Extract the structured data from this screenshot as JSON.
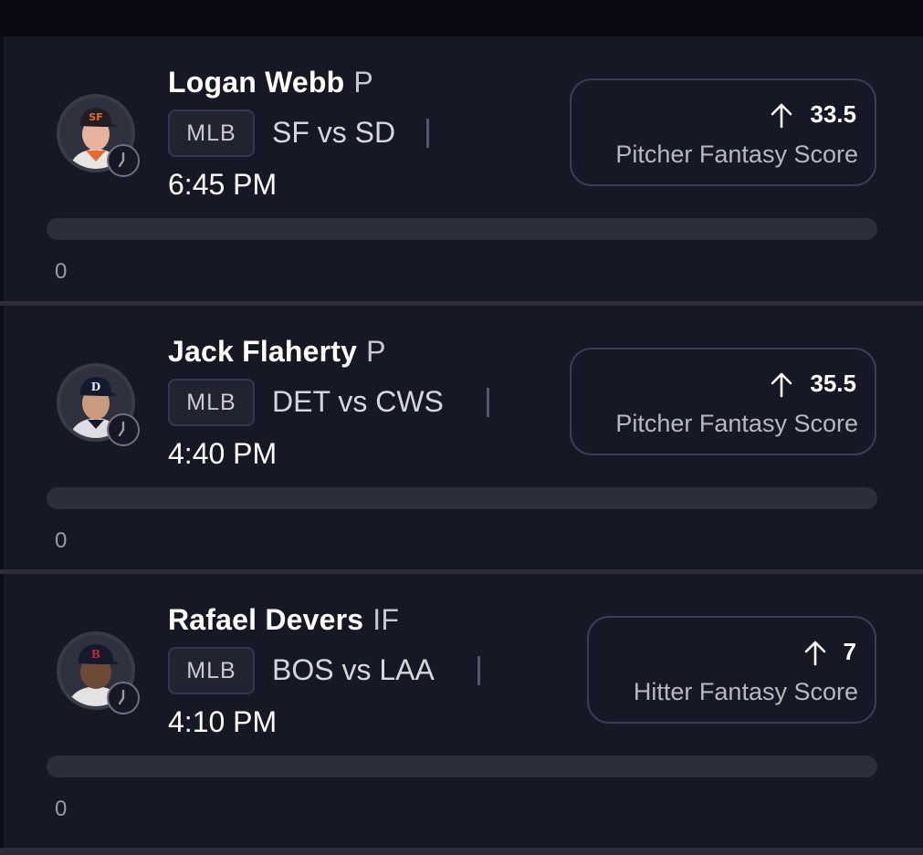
{
  "players": [
    {
      "name": "Logan Webb",
      "position": "P",
      "league": "MLB",
      "matchup": "SF vs SD",
      "time": "6:45 PM",
      "projection": "33.5",
      "stat": "Pitcher Fantasy Score",
      "progress_value": "0",
      "progress_fraction": 0,
      "avatar_icon": "player-headshot-icon",
      "cap_color": "#1f1f24",
      "cap_logo_color": "#e86b2b"
    },
    {
      "name": "Jack Flaherty",
      "position": "P",
      "league": "MLB",
      "matchup": "DET vs CWS",
      "time": "4:40 PM",
      "projection": "35.5",
      "stat": "Pitcher Fantasy Score",
      "progress_value": "0",
      "progress_fraction": 0,
      "avatar_icon": "player-headshot-icon",
      "cap_color": "#141a2e",
      "cap_logo_color": "#e9e9ef"
    },
    {
      "name": "Rafael Devers",
      "position": "IF",
      "league": "MLB",
      "matchup": "BOS vs LAA",
      "time": "4:10 PM",
      "projection": "7",
      "stat": "Hitter Fantasy Score",
      "progress_value": "0",
      "progress_fraction": 0,
      "avatar_icon": "player-headshot-icon",
      "cap_color": "#15192c",
      "cap_logo_color": "#c4283a"
    }
  ],
  "icons": {
    "up_arrow": "arrow-up-icon",
    "clock": "clock-icon"
  },
  "colors": {
    "card_bg": "#171825",
    "page_bg": "#0c0c16",
    "text_primary": "#ffffff",
    "text_secondary": "#b7b8c2"
  }
}
